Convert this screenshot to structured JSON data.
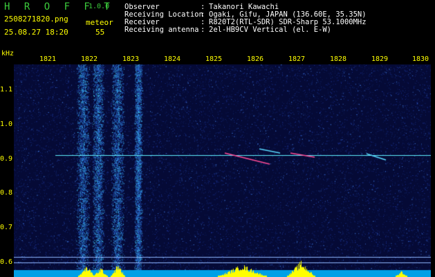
{
  "header": {
    "brand": "H R O F F T",
    "version": "1.0.0",
    "filename": "2508271820.png",
    "datetime": "25.08.27 18:20",
    "event_type": "meteor",
    "event_count": "55",
    "info": [
      {
        "label": "Observer",
        "value": "Takanori Kawachi"
      },
      {
        "label": "Receiving Location",
        "value": "Ogaki, Gifu, JAPAN (136.60E, 35.35N)"
      },
      {
        "label": "Receiver",
        "value": "R820T2(RTL-SDR) SDR-Sharp 53.1000MHz"
      },
      {
        "label": "Receiving antenna",
        "value": "2el-HB9CV Vertical (el. E-W)"
      }
    ]
  },
  "axis": {
    "y_unit": "kHz",
    "x_ticks": [
      "1821",
      "1822",
      "1823",
      "1824",
      "1825",
      "1826",
      "1827",
      "1828",
      "1829",
      "1830"
    ],
    "y_ticks": [
      "1.1",
      "1.0",
      "0.9",
      "0.8",
      "0.7",
      "0.6"
    ]
  },
  "colors": {
    "background": "#000000",
    "spectrum_low": "#0a1450",
    "spectrum_high": "#39e6ff",
    "label_yellow": "#ffff00",
    "brand_green": "#3ccc3c",
    "carrier": "#5ff0ff",
    "meteor_echo": "#ff4b96",
    "activity_bar": "#ffff00",
    "noise_floor": "#00a0e6"
  }
}
